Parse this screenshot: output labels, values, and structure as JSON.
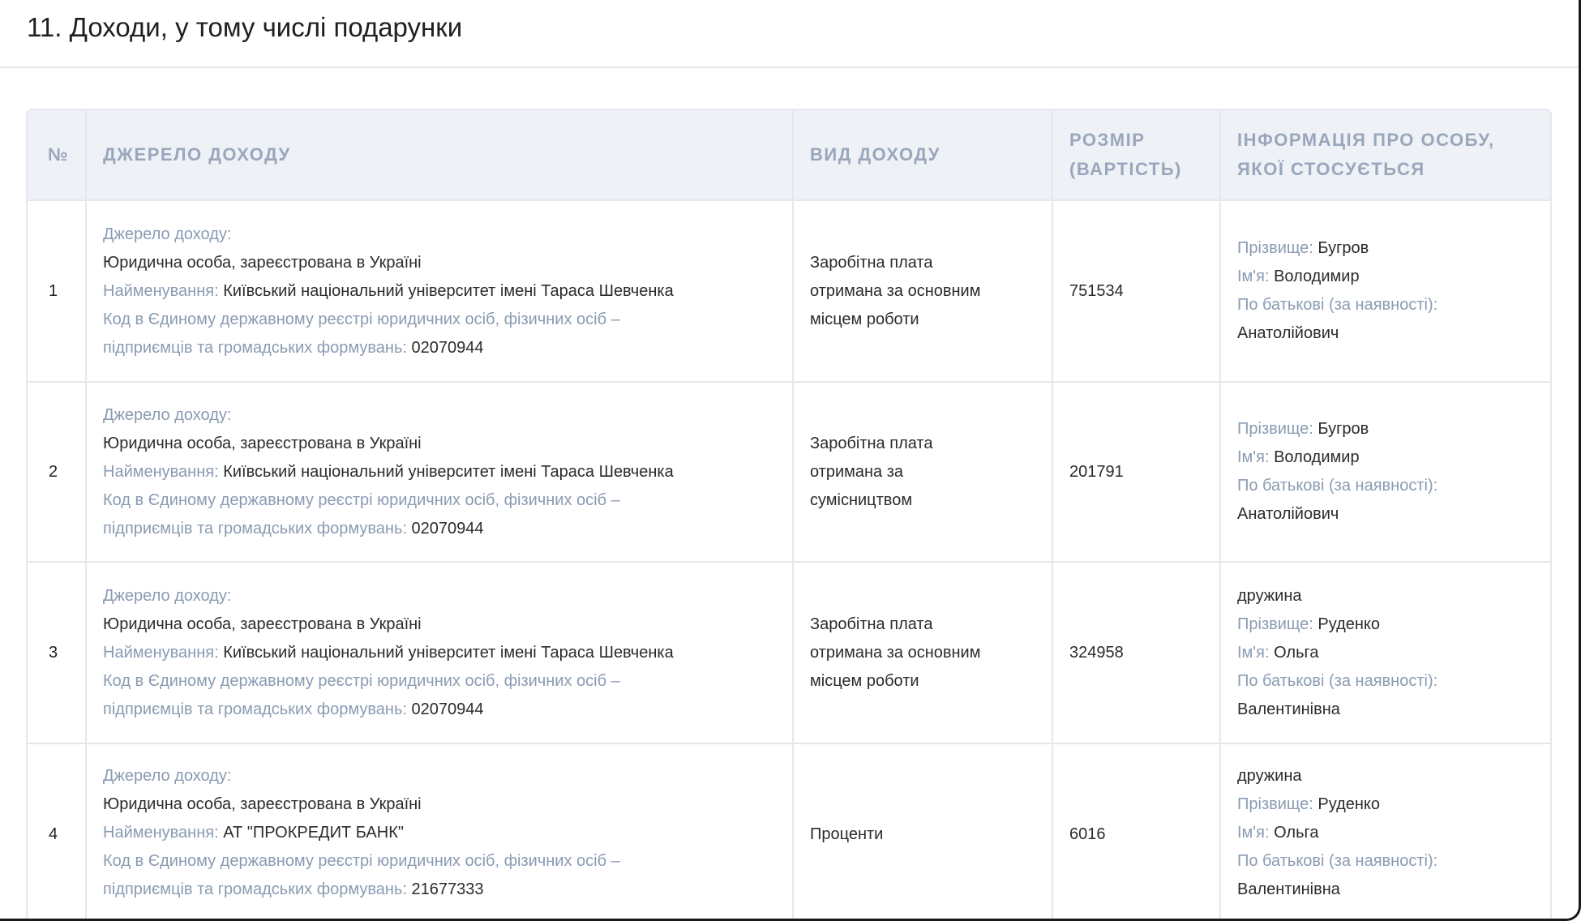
{
  "section": {
    "title": "11. Доходи, у тому числі подарунки"
  },
  "table": {
    "headers": {
      "num": "№",
      "source": "ДЖЕРЕЛО ДОХОДУ",
      "kind": "ВИД ДОХОДУ",
      "amount_line1": "РОЗМІР",
      "amount_line2": "(ВАРТІСТЬ)",
      "person_line1": "ІНФОРМАЦІЯ ПРО ОСОБУ,",
      "person_line2": "ЯКОЇ СТОСУЄТЬСЯ"
    },
    "labels": {
      "source": "Джерело доходу:",
      "name": "Найменування:",
      "code_line1": "Код в Єдиному державному реєстрі юридичних осіб, фізичних осіб –",
      "code_line2": "підприємців та громадських формувань:",
      "surname": "Прізвище:",
      "first_name": "Ім'я:",
      "patronymic": "По батькові (за наявності):"
    },
    "rows": [
      {
        "num": "1",
        "source_type": "Юридична особа, зареєстрована в Україні",
        "source_name": "Київський національний університет імені Тараса Шевченка",
        "source_code": "02070944",
        "kind_line1": "Заробітна плата",
        "kind_line2": "отримана за основним",
        "kind_line3": "місцем роботи",
        "amount": "751534",
        "relation": "",
        "surname": "Бугров",
        "first_name": "Володимир",
        "patronymic": "Анатолійович"
      },
      {
        "num": "2",
        "source_type": "Юридична особа, зареєстрована в Україні",
        "source_name": "Київський національний університет імені Тараса Шевченка",
        "source_code": "02070944",
        "kind_line1": "Заробітна плата",
        "kind_line2": "отримана за",
        "kind_line3": "сумісництвом",
        "amount": "201791",
        "relation": "",
        "surname": "Бугров",
        "first_name": "Володимир",
        "patronymic": "Анатолійович"
      },
      {
        "num": "3",
        "source_type": "Юридична особа, зареєстрована в Україні",
        "source_name": "Київський національний університет імені Тараса Шевченка",
        "source_code": "02070944",
        "kind_line1": "Заробітна плата",
        "kind_line2": "отримана за основним",
        "kind_line3": "місцем роботи",
        "amount": "324958",
        "relation": "дружина",
        "surname": "Руденко",
        "first_name": "Ольга",
        "patronymic": "Валентинівна"
      },
      {
        "num": "4",
        "source_type": "Юридична особа, зареєстрована в Україні",
        "source_name": "АТ \"ПРОКРЕДИТ БАНК\"",
        "source_code": "21677333",
        "kind_line1": "Проценти",
        "kind_line2": "",
        "kind_line3": "",
        "amount": "6016",
        "relation": "дружина",
        "surname": "Руденко",
        "first_name": "Ольга",
        "patronymic": "Валентинівна"
      }
    ]
  }
}
